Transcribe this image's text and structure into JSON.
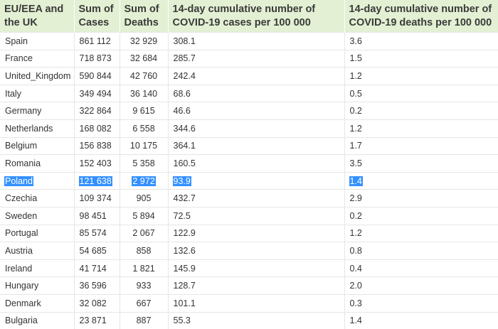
{
  "headers": [
    "EU/EEA and the UK",
    "Sum of Cases",
    "Sum of Deaths",
    "14-day cumulative number of COVID-19 cases per 100 000",
    "14-day cumulative number of COVID-19 deaths per 100 000"
  ],
  "rows": [
    {
      "country": "Spain",
      "cases": "861 112",
      "deaths": "32 929",
      "cases14": "308.1",
      "deaths14": "3.6"
    },
    {
      "country": "France",
      "cases": "718 873",
      "deaths": "32 684",
      "cases14": "285.7",
      "deaths14": "1.5"
    },
    {
      "country": "United_Kingdom",
      "cases": "590 844",
      "deaths": "42 760",
      "cases14": "242.4",
      "deaths14": "1.2"
    },
    {
      "country": "Italy",
      "cases": "349 494",
      "deaths": "36 140",
      "cases14": "68.6",
      "deaths14": "0.5"
    },
    {
      "country": "Germany",
      "cases": "322 864",
      "deaths": "9 615",
      "cases14": "46.6",
      "deaths14": "0.2"
    },
    {
      "country": "Netherlands",
      "cases": "168 082",
      "deaths": "6 558",
      "cases14": "344.6",
      "deaths14": "1.2"
    },
    {
      "country": "Belgium",
      "cases": "156 838",
      "deaths": "10 175",
      "cases14": "364.1",
      "deaths14": "1.7"
    },
    {
      "country": "Romania",
      "cases": "152 403",
      "deaths": "5 358",
      "cases14": "160.5",
      "deaths14": "3.5"
    },
    {
      "country": "Poland",
      "cases": "121 638",
      "deaths": "2 972",
      "cases14": "93.9",
      "deaths14": "1.4"
    },
    {
      "country": "Czechia",
      "cases": "109 374",
      "deaths": "905",
      "cases14": "432.7",
      "deaths14": "2.9"
    },
    {
      "country": "Sweden",
      "cases": "98 451",
      "deaths": "5 894",
      "cases14": "72.5",
      "deaths14": "0.2"
    },
    {
      "country": "Portugal",
      "cases": "85 574",
      "deaths": "2 067",
      "cases14": "122.9",
      "deaths14": "1.2"
    },
    {
      "country": "Austria",
      "cases": "54 685",
      "deaths": "858",
      "cases14": "132.6",
      "deaths14": "0.8"
    },
    {
      "country": "Ireland",
      "cases": "41 714",
      "deaths": "1 821",
      "cases14": "145.9",
      "deaths14": "0.4"
    },
    {
      "country": "Hungary",
      "cases": "36 596",
      "deaths": "933",
      "cases14": "128.7",
      "deaths14": "2.0"
    },
    {
      "country": "Denmark",
      "cases": "32 082",
      "deaths": "667",
      "cases14": "101.1",
      "deaths14": "0.3"
    },
    {
      "country": "Bulgaria",
      "cases": "23 871",
      "deaths": "887",
      "cases14": "55.3",
      "deaths14": "1.4"
    }
  ],
  "selected_row": "Poland",
  "colors": {
    "header_bg": "#e3f0d3",
    "selection_bg": "#3390ff",
    "selection_text": "#ffffff",
    "grid_line": "#e6e6e6"
  }
}
